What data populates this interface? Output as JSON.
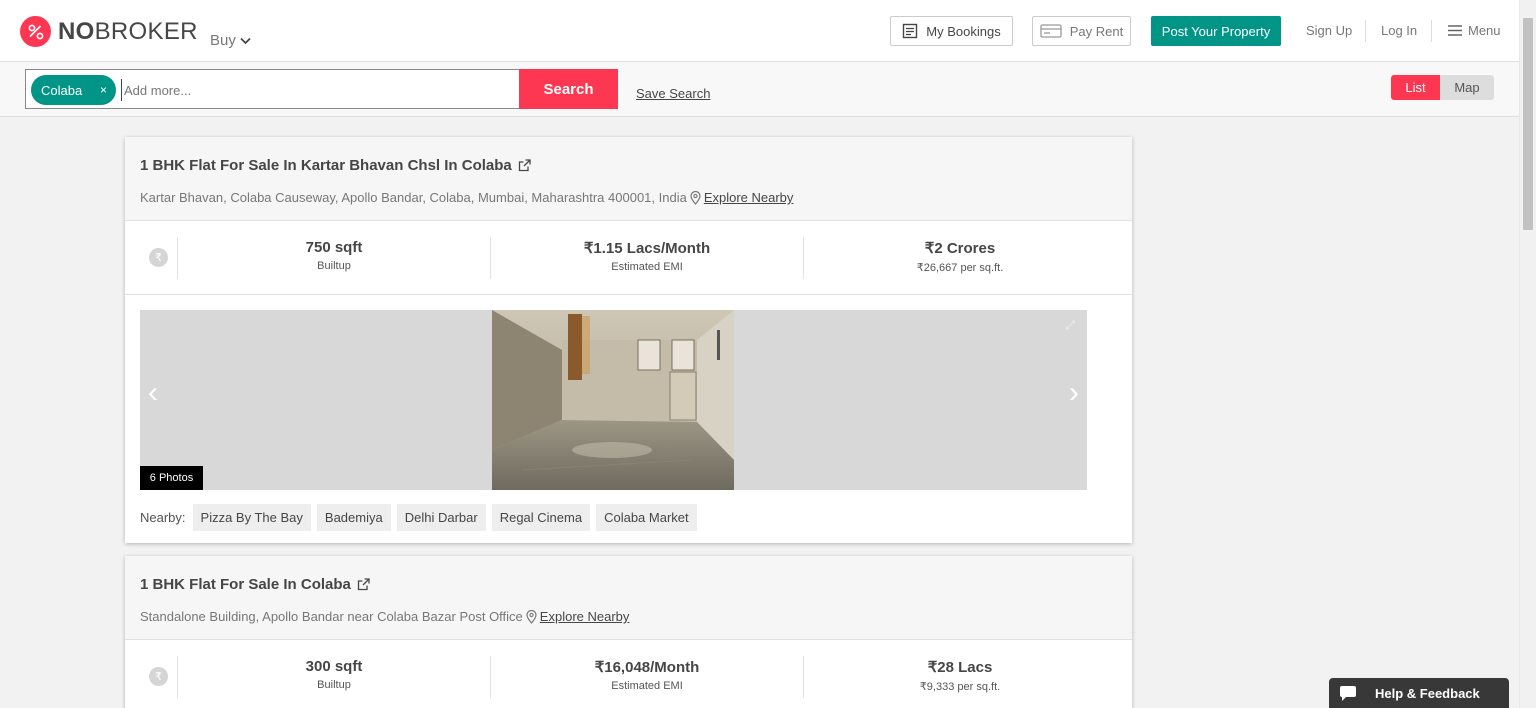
{
  "header": {
    "logo_strong": "NO",
    "logo_light": "BROKER",
    "buy_label": "Buy",
    "my_bookings": "My Bookings",
    "pay_rent": "Pay Rent",
    "post_property": "Post Your Property",
    "sign_up": "Sign Up",
    "log_in": "Log In",
    "menu": "Menu",
    "brand_color": "#fd3752",
    "accent_color": "#009587"
  },
  "search": {
    "chip_label": "Colaba",
    "chip_close": "×",
    "placeholder": "Add more...",
    "button_label": "Search",
    "save_search": "Save Search"
  },
  "view_toggle": {
    "list": "List",
    "map": "Map",
    "selected": "List"
  },
  "listings": [
    {
      "title": "1 BHK Flat For Sale In Kartar Bhavan Chsl In Colaba",
      "address": "Kartar Bhavan, Colaba Causeway, Apollo Bandar, Colaba, Mumbai, Maharashtra 400001, India",
      "explore_nearby": "Explore Nearby",
      "area_value": "750 sqft",
      "area_label": "Builtup",
      "emi_value": "₹1.15 Lacs/Month",
      "emi_label": "Estimated EMI",
      "price_value": "₹2 Crores",
      "price_per_sqft": "₹26,667 per sq.ft.",
      "photos_count": "6 Photos",
      "nearby_label": "Nearby:",
      "nearby": [
        "Pizza By The Bay",
        "Bademiya",
        "Delhi Darbar",
        "Regal Cinema",
        "Colaba Market"
      ]
    },
    {
      "title": "1 BHK Flat For Sale In Colaba",
      "address": "Standalone Building, Apollo Bandar near Colaba Bazar Post Office",
      "explore_nearby": "Explore Nearby",
      "area_value": "300 sqft",
      "area_label": "Builtup",
      "emi_value": "₹16,048/Month",
      "emi_label": "Estimated EMI",
      "price_value": "₹28 Lacs",
      "price_per_sqft": "₹9,333 per sq.ft."
    }
  ],
  "help_widget": {
    "label": "Help & Feedback"
  }
}
